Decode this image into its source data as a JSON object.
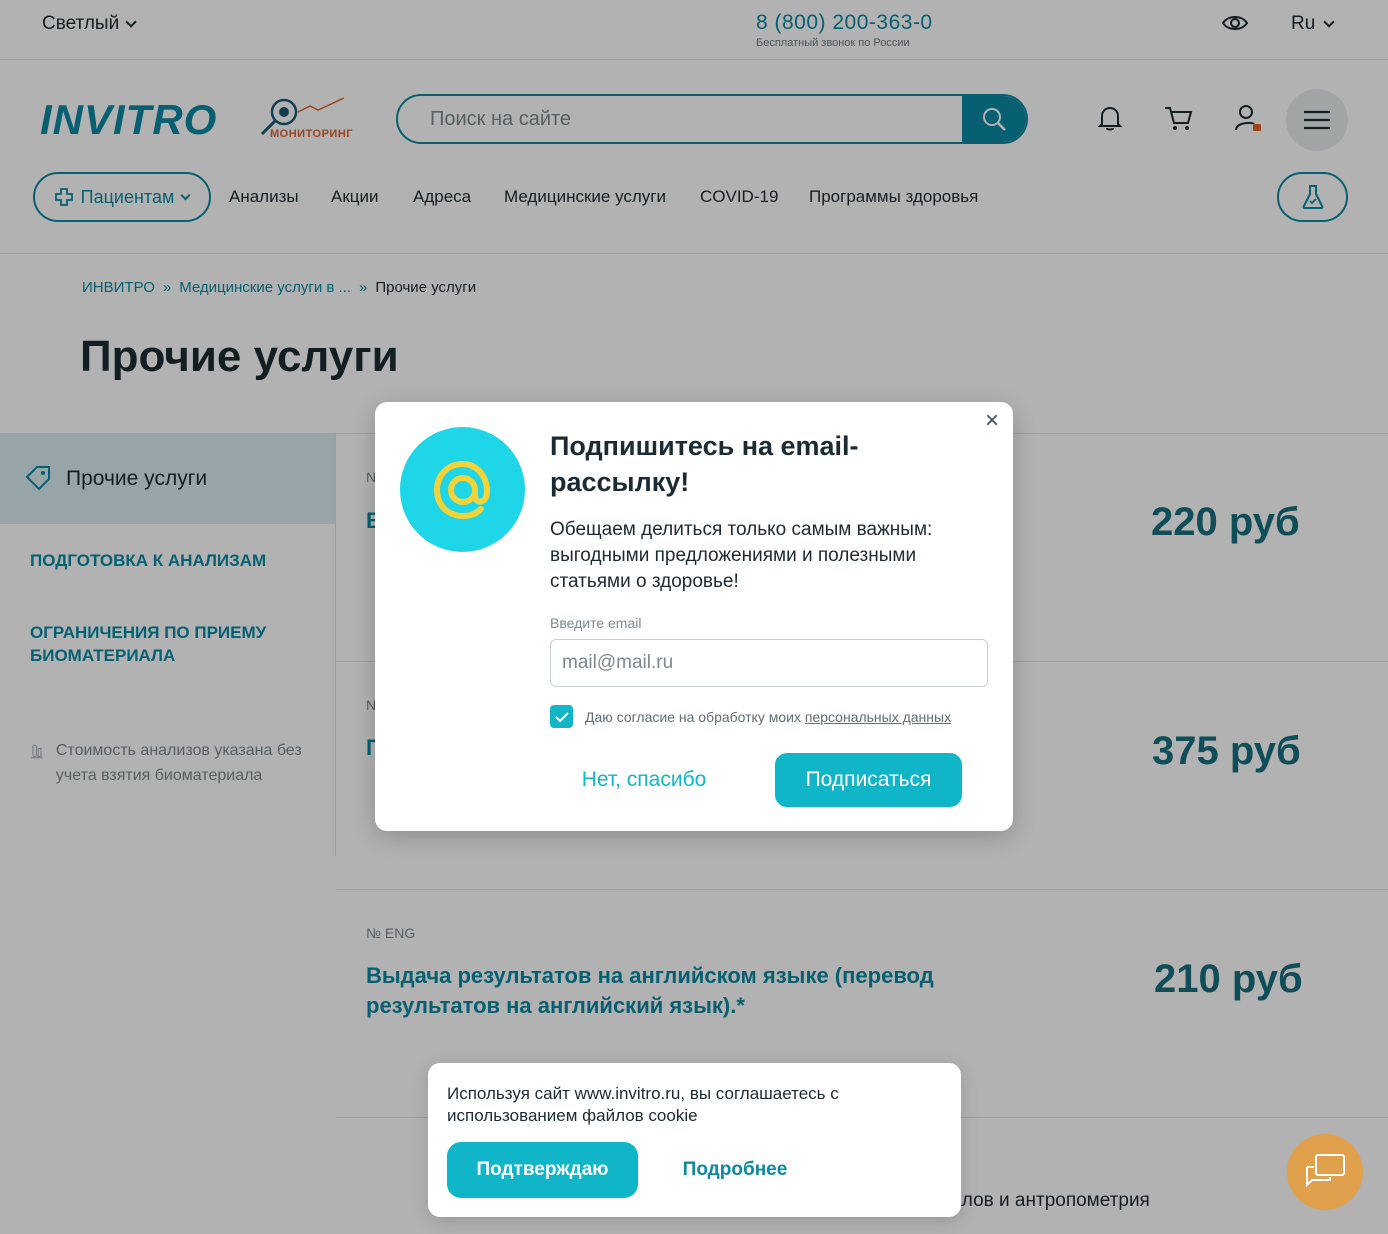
{
  "topbar": {
    "city": "Светлый",
    "phone": "8 (800) 200-363-0",
    "phone_note": "Бесплатный звонок по России",
    "lang": "Ru"
  },
  "header": {
    "logo": "INVITRO",
    "monitor_label": "МОНИТОРИНГ",
    "search_placeholder": "Поиск на сайте"
  },
  "nav": {
    "patients": "Пациентам",
    "items": [
      "Анализы",
      "Акции",
      "Адреса",
      "Медицинские услуги",
      "COVID-19",
      "Программы здоровья"
    ]
  },
  "breadcrumb": {
    "items": [
      "ИНВИТРО",
      "Медицинские услуги в ...",
      "Прочие услуги"
    ],
    "separator": "»"
  },
  "page": {
    "title": "Прочие услуги"
  },
  "sidebar": {
    "active": "Прочие услуги",
    "links": [
      "ПОДГОТОВКА К АНАЛИЗАМ",
      "ОГРАНИЧЕНИЯ ПО ПРИЕМУ БИОМАТЕРИАЛА"
    ],
    "note": "Стоимость анализов указана без учета взятия биоматериала"
  },
  "services": [
    {
      "code": "N",
      "name": "В",
      "price": "220 руб"
    },
    {
      "code": "N",
      "name": "П",
      "price": "375 руб"
    },
    {
      "code": "№ ENG",
      "name": "Выдача результатов на английском языке (перевод результатов на английский язык).*",
      "price": "210 руб"
    }
  ],
  "bottom_text": "в Светлом в ИНВИТРО: взятие биоматериалов и антропометрия",
  "modal": {
    "title": "Подпишитесь на email-рассылку!",
    "description": "Обещаем делиться только самым важным: выгодными предложениями и полезными статьями о здоровье!",
    "email_label": "Введите email",
    "email_placeholder": "mail@mail.ru",
    "consent_text": "Даю согласие на обработку моих",
    "consent_link": "персональных данных",
    "consent_checked": true,
    "decline": "Нет, спасибо",
    "subscribe": "Подписаться",
    "close": "×"
  },
  "cookie": {
    "text": "Используя сайт www.invitro.ru, вы соглашаетесь с использованием файлов cookie",
    "confirm": "Подтверждаю",
    "more": "Подробнее"
  },
  "colors": {
    "brand": "#0b8aa3",
    "accent": "#10b6c8",
    "price": "#16707f",
    "monitor": "#e0632a",
    "chat": "#e0a04c"
  },
  "icons": [
    "eye-icon",
    "search-icon",
    "bell-icon",
    "cart-icon",
    "user-lock-icon",
    "menu-icon",
    "plus-icon",
    "flask-icon",
    "tag-icon",
    "test-tube-icon",
    "at-icon",
    "check-icon",
    "chat-icon"
  ]
}
